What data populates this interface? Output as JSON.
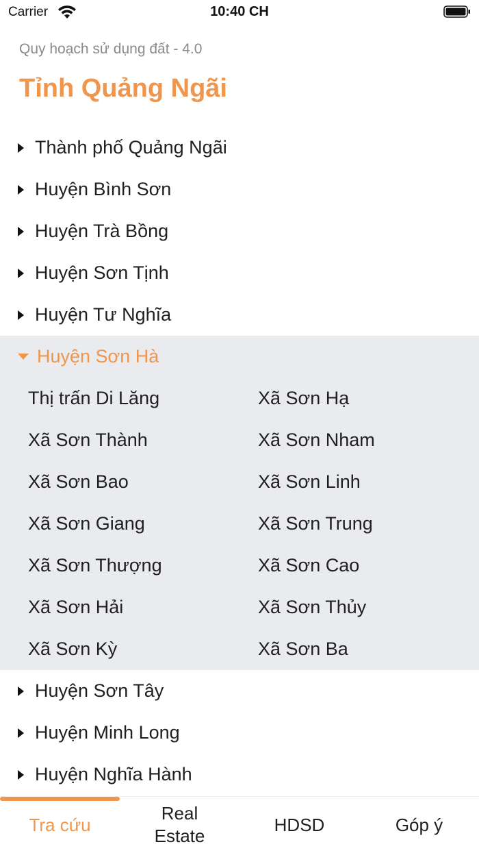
{
  "status_bar": {
    "carrier": "Carrier",
    "time": "10:40 CH"
  },
  "header": {
    "subtitle": "Quy hoạch sử dụng đất - 4.0",
    "title": "Tỉnh Quảng Ngãi"
  },
  "districts_before": [
    {
      "label": "Thành phố Quảng Ngãi"
    },
    {
      "label": "Huyện Bình Sơn"
    },
    {
      "label": "Huyện Trà Bồng"
    },
    {
      "label": "Huyện Sơn Tịnh"
    },
    {
      "label": "Huyện Tư Nghĩa"
    }
  ],
  "expanded_district": {
    "label": "Huyện Sơn Hà",
    "communes": [
      "Thị trấn Di Lăng",
      "Xã Sơn Hạ",
      "Xã Sơn Thành",
      "Xã Sơn Nham",
      "Xã Sơn Bao",
      "Xã Sơn Linh",
      "Xã Sơn Giang",
      "Xã Sơn Trung",
      "Xã Sơn Thượng",
      "Xã Sơn Cao",
      "Xã Sơn Hải",
      "Xã Sơn Thủy",
      "Xã Sơn Kỳ",
      "Xã Sơn Ba"
    ]
  },
  "districts_after": [
    {
      "label": "Huyện Sơn Tây"
    },
    {
      "label": "Huyện Minh Long"
    },
    {
      "label": "Huyện Nghĩa Hành"
    }
  ],
  "tabs": [
    {
      "label": "Tra cứu",
      "active": true
    },
    {
      "label": "Real Estate",
      "active": false
    },
    {
      "label": "HDSD",
      "active": false
    },
    {
      "label": "Góp ý",
      "active": false
    }
  ],
  "colors": {
    "accent": "#f0954c",
    "expanded_background": "#e9ebee",
    "subtitle": "#8a8a8a"
  }
}
